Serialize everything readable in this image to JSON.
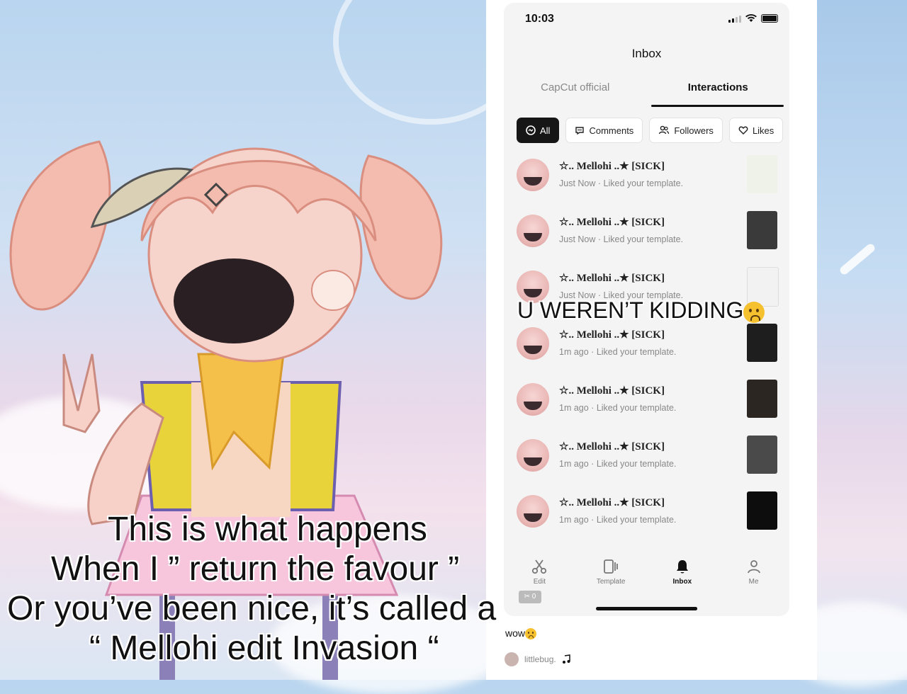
{
  "status_bar": {
    "time": "10:03"
  },
  "header": {
    "title": "Inbox"
  },
  "tabs": [
    {
      "label": "CapCut official",
      "active": false
    },
    {
      "label": "Interactions",
      "active": true
    }
  ],
  "filters": [
    {
      "label": "All",
      "icon": "all-icon",
      "active": true
    },
    {
      "label": "Comments",
      "icon": "comment-icon",
      "active": false
    },
    {
      "label": "Followers",
      "icon": "followers-icon",
      "active": false
    },
    {
      "label": "Likes",
      "icon": "heart-icon",
      "active": false
    }
  ],
  "notifications": [
    {
      "name": "☆.. Mellohi ..★ [SICK]",
      "time": "Just Now",
      "action": "Liked your template."
    },
    {
      "name": "☆.. Mellohi ..★ [SICK]",
      "time": "Just Now",
      "action": "Liked your template."
    },
    {
      "name": "☆.. Mellohi ..★ [SICK]",
      "time": "Just Now",
      "action": "Liked your template."
    },
    {
      "name": "☆.. Mellohi ..★ [SICK]",
      "time": "1m ago",
      "action": "Liked your template."
    },
    {
      "name": "☆.. Mellohi ..★ [SICK]",
      "time": "1m ago",
      "action": "Liked your template."
    },
    {
      "name": "☆.. Mellohi ..★ [SICK]",
      "time": "1m ago",
      "action": "Liked your template."
    },
    {
      "name": "☆.. Mellohi ..★ [SICK]",
      "time": "1m ago",
      "action": "Liked your template."
    }
  ],
  "separator": " · ",
  "bottom_nav": [
    {
      "label": "Edit",
      "icon": "scissors-icon",
      "active": false
    },
    {
      "label": "Template",
      "icon": "template-icon",
      "active": false
    },
    {
      "label": "Inbox",
      "icon": "bell-icon",
      "active": true
    },
    {
      "label": "Me",
      "icon": "person-icon",
      "active": false
    }
  ],
  "overlay": {
    "kidding": "U WEREN’T KIDDING",
    "caption_lines": [
      "This is what happens",
      "When I ” return the favour ”",
      "Or you’ve been nice, it’s called a",
      "“ Mellohi edit Invasion “"
    ],
    "wow": "wow",
    "credit": "littlebug.",
    "badge": "✂ 0"
  },
  "colors": {
    "accent": "#161616",
    "skin": "#f3c3b9",
    "hair": "#f0b8a8"
  }
}
